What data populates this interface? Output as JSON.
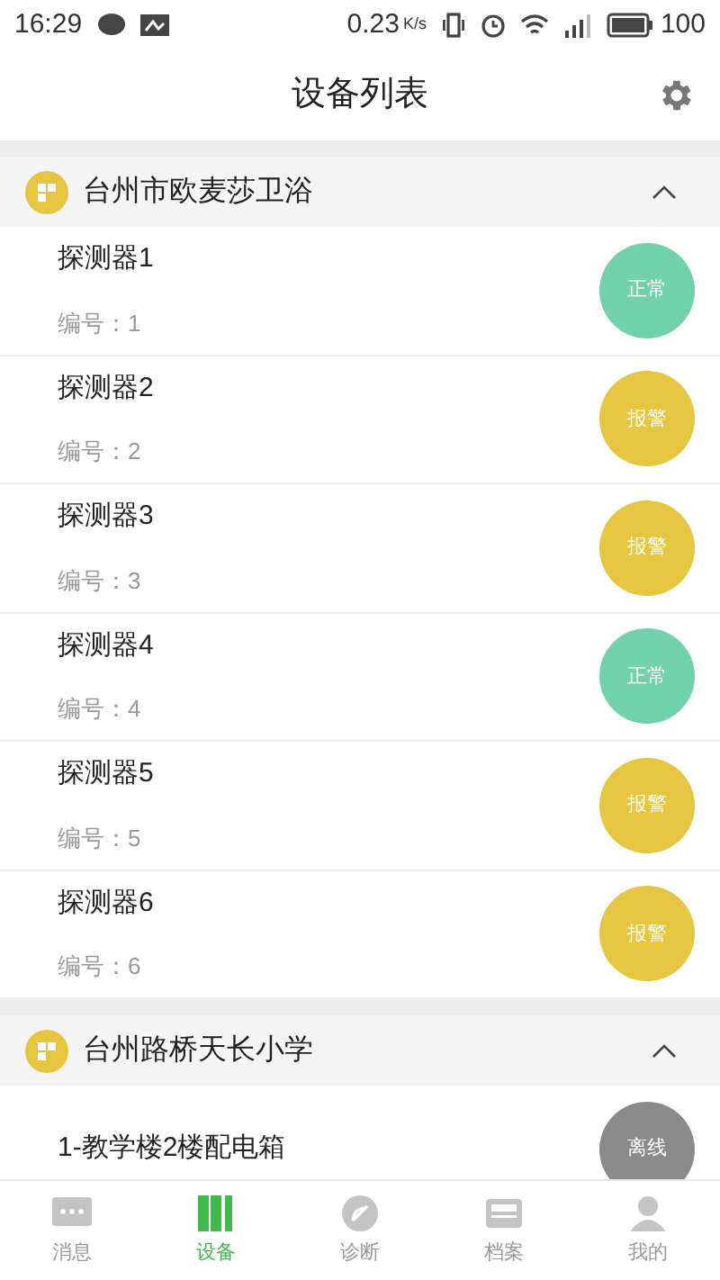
{
  "status_bar": {
    "time": "16:29",
    "speed": "0.23",
    "speed_unit": "K/s",
    "battery": "100"
  },
  "header": {
    "title": "设备列表"
  },
  "groups": [
    {
      "name": "台州市欧麦莎卫浴",
      "expanded": true,
      "devices": [
        {
          "name": "探测器1",
          "number": "编号：1",
          "status": "正常",
          "kind": "normal"
        },
        {
          "name": "探测器2",
          "number": "编号：2",
          "status": "报警",
          "kind": "alarm"
        },
        {
          "name": "探测器3",
          "number": "编号：3",
          "status": "报警",
          "kind": "alarm"
        },
        {
          "name": "探测器4",
          "number": "编号：4",
          "status": "正常",
          "kind": "normal"
        },
        {
          "name": "探测器5",
          "number": "编号：5",
          "status": "报警",
          "kind": "alarm"
        },
        {
          "name": "探测器6",
          "number": "编号：6",
          "status": "报警",
          "kind": "alarm"
        }
      ]
    },
    {
      "name": "台州路桥天长小学",
      "expanded": true,
      "devices": [
        {
          "name": "1-教学楼2楼配电箱",
          "status": "离线",
          "kind": "offline"
        }
      ]
    }
  ],
  "tabs": [
    {
      "label": "消息",
      "selected": false,
      "kind": "message"
    },
    {
      "label": "设备",
      "selected": true,
      "kind": "device"
    },
    {
      "label": "诊断",
      "selected": false,
      "kind": "diagnose"
    },
    {
      "label": "档案",
      "selected": false,
      "kind": "archive"
    },
    {
      "label": "我的",
      "selected": false,
      "kind": "me"
    }
  ]
}
